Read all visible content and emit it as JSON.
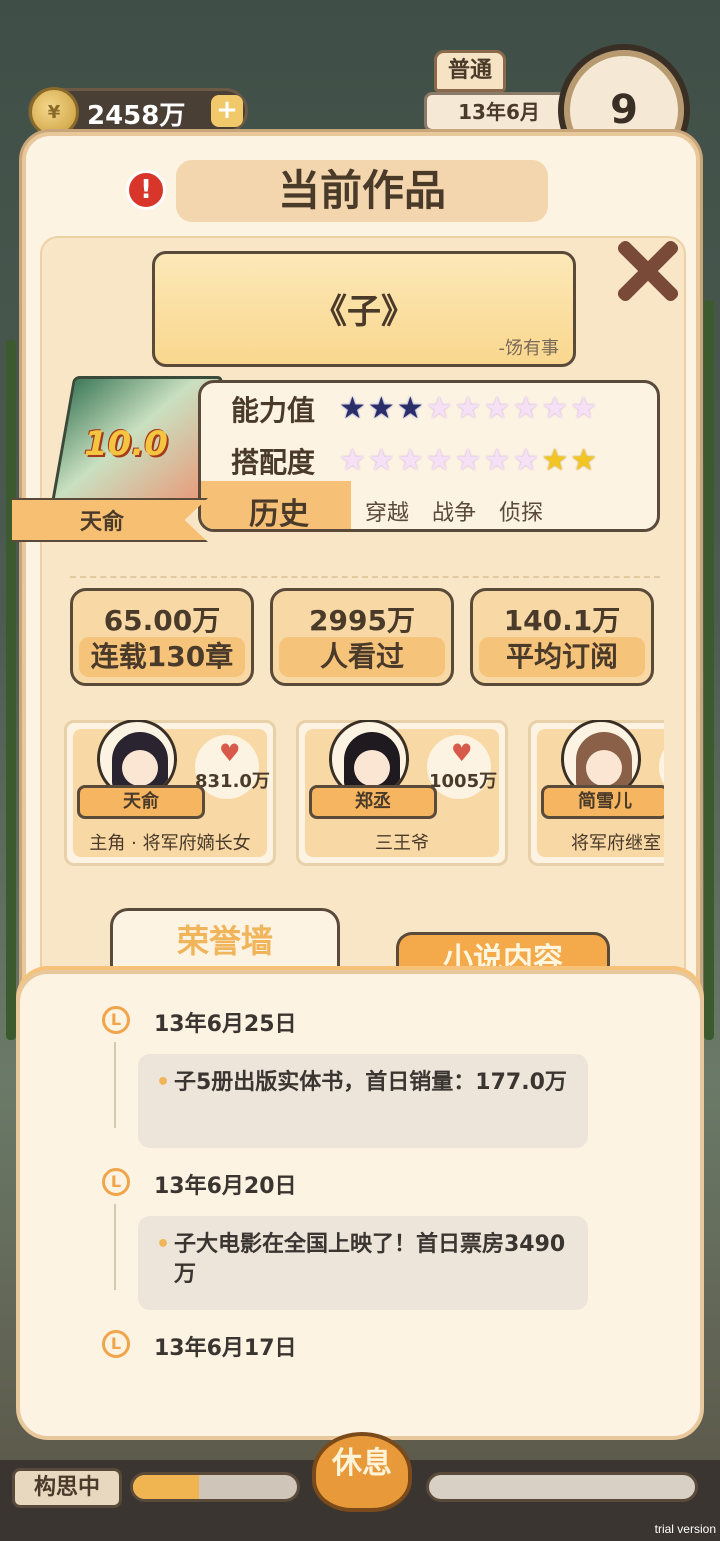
{
  "hud": {
    "coins": "2458万",
    "coin_plus": "+",
    "mode": "普通",
    "date": "13年6月",
    "clock_day": "9"
  },
  "panel": {
    "title": "当前作品",
    "alert": "!"
  },
  "book": {
    "title": "《子》",
    "author": "-饧有事",
    "score": "10.0",
    "lead": "天俞",
    "ability_label": "能力值",
    "ability_stars": [
      "dark",
      "dark",
      "dark",
      "pastel",
      "pastel",
      "pastel",
      "pastel",
      "pastel",
      "pastel"
    ],
    "match_label": "搭配度",
    "match_stars": [
      "pastel",
      "pastel",
      "pastel",
      "pastel",
      "pastel",
      "pastel",
      "pastel",
      "gold",
      "gold"
    ],
    "genre": "历史",
    "tags": [
      "穿越",
      "战争",
      "侦探"
    ]
  },
  "metrics": [
    {
      "value": "65.00万",
      "label": "连载130章"
    },
    {
      "value": "2995万",
      "label": "人看过"
    },
    {
      "value": "140.1万",
      "label": "平均订阅"
    }
  ],
  "characters": [
    {
      "name": "天俞",
      "likes": "831.0万",
      "role": "主角 · 将军府嫡长女",
      "hair": "#2a2430"
    },
    {
      "name": "郑丞",
      "likes": "1005万",
      "role": "三王爷",
      "hair": "#1e1a20"
    },
    {
      "name": "简雪儿",
      "likes": "",
      "role": "将军府继室",
      "hair": "#8a6048"
    }
  ],
  "tabs": {
    "honor": "荣誉墙",
    "content": "小说内容"
  },
  "timeline": [
    {
      "date": "13年6月25日",
      "text": "子5册出版实体书，首日销量：177.0万"
    },
    {
      "date": "13年6月20日",
      "text": "子大电影在全国上映了！首日票房3490万"
    },
    {
      "date": "13年6月17日",
      "text": ""
    }
  ],
  "bottom": {
    "thinking": "构思中",
    "thinking_progress": 0.4,
    "rest": "休息",
    "trial": "trial version"
  },
  "colors": {
    "panel_bg": "#fdf3e3",
    "accent_orange": "#f0b55a",
    "text_dark": "#4a3a2a"
  }
}
